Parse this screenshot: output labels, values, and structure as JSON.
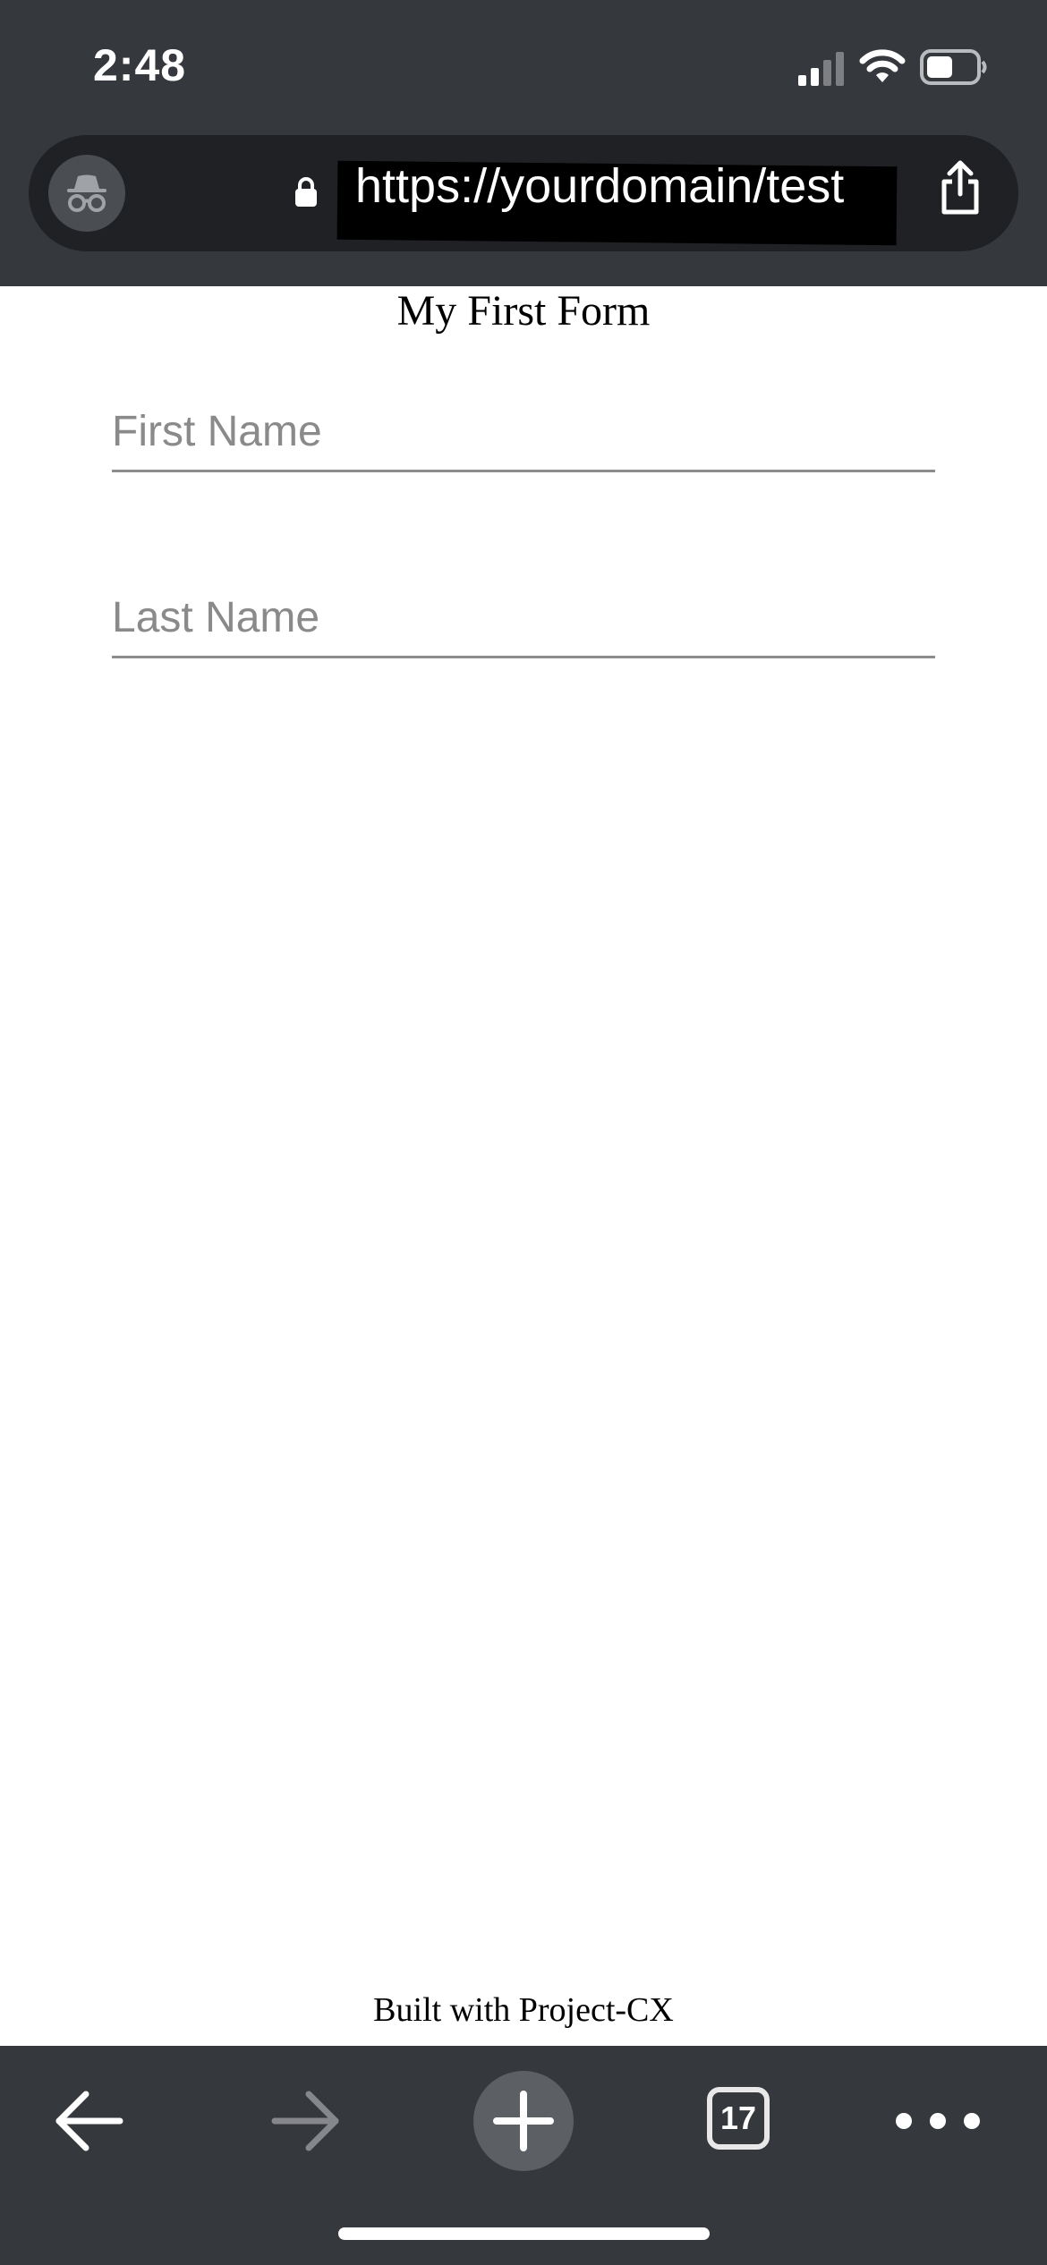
{
  "status_bar": {
    "time": "2:48",
    "icons": [
      "signal-icon",
      "wifi-icon",
      "battery-icon"
    ]
  },
  "browser": {
    "url": "https://yourdomain/test",
    "mode": "incognito",
    "tab_count": "17",
    "colors": {
      "chrome": "#35383c",
      "address_bar": "#1f2124"
    }
  },
  "page": {
    "title": "My First Form",
    "fields": {
      "first_name": {
        "value": "",
        "placeholder": "First Name"
      },
      "last_name": {
        "value": "",
        "placeholder": "Last Name"
      }
    },
    "footer": "Built with Project-CX"
  },
  "toolbar": {
    "icons": [
      "back-arrow-icon",
      "forward-arrow-icon",
      "plus-icon",
      "tab-switcher-icon",
      "more-dots-icon"
    ]
  }
}
